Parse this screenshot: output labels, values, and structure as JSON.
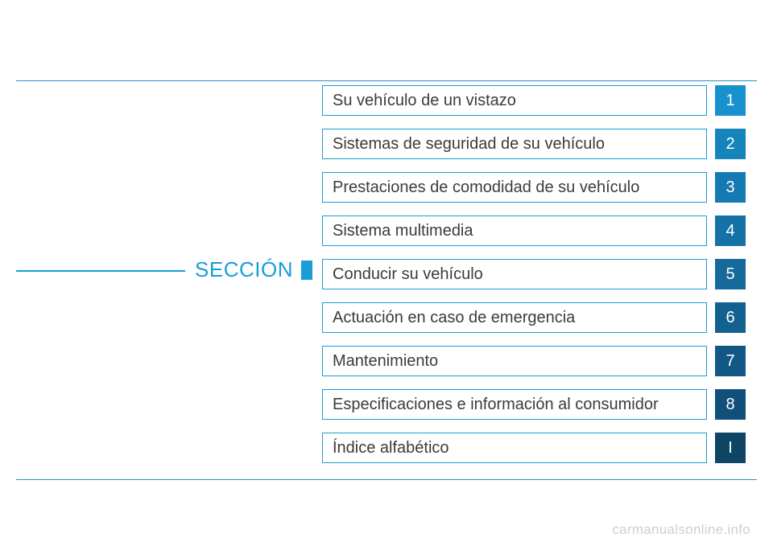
{
  "heading": "SECCIÓN",
  "sections": [
    {
      "title": "Su vehículo de un vistazo",
      "num": "1",
      "bg": "#1892cf"
    },
    {
      "title": "Sistemas de seguridad de su vehículo",
      "num": "2",
      "bg": "#1484bb"
    },
    {
      "title": "Prestaciones de comodidad de su vehículo",
      "num": "3",
      "bg": "#157ab1"
    },
    {
      "title": "Sistema multimedia",
      "num": "4",
      "bg": "#1572a6"
    },
    {
      "title": "Conducir su vehículo",
      "num": "5",
      "bg": "#156a9b"
    },
    {
      "title": "Actuación en caso de emergencia",
      "num": "6",
      "bg": "#136190"
    },
    {
      "title": "Mantenimiento",
      "num": "7",
      "bg": "#115885"
    },
    {
      "title": "Especificaciones e información al consumidor",
      "num": "8",
      "bg": "#104f7a"
    },
    {
      "title": "Índice alfabético",
      "num": "I",
      "bg": "#0e4464"
    }
  ],
  "watermark": "carmanualsonline.info"
}
